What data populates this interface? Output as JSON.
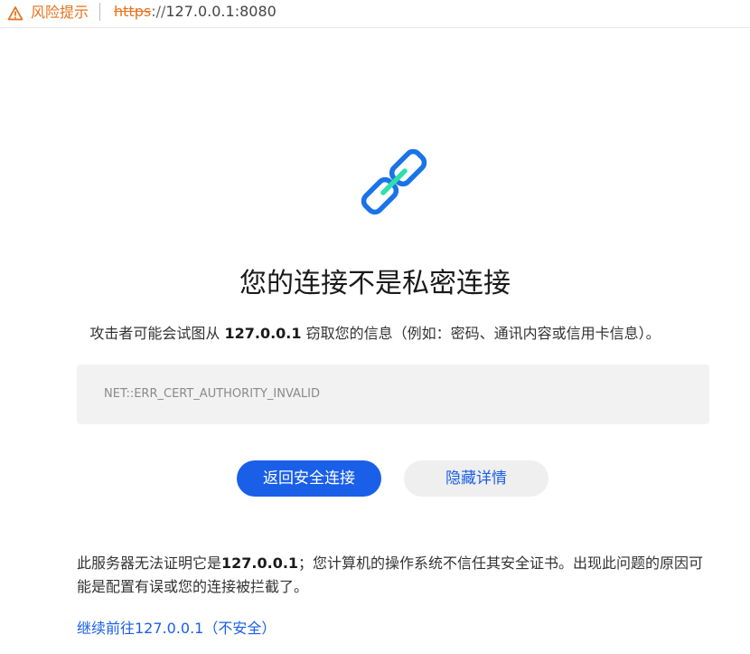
{
  "addressbar": {
    "warning_label": "风险提示",
    "url_scheme": "https",
    "url_separator": "://",
    "url_host": "127.0.0.1:8080"
  },
  "icons": {
    "warning": "warning-triangle-icon",
    "hero": "broken-link-icon"
  },
  "main": {
    "title": "您的连接不是私密连接",
    "desc_prefix": "攻击者可能会试图从 ",
    "desc_host": "127.0.0.1",
    "desc_suffix": " 窃取您的信息（例如：密码、通讯内容或信用卡信息）。",
    "error_code": "NET::ERR_CERT_AUTHORITY_INVALID",
    "back_button": "返回安全连接",
    "details_button": "隐藏详情",
    "detail_prefix": "此服务器无法证明它是",
    "detail_host": "127.0.0.1",
    "detail_suffix": "；您计算机的操作系统不信任其安全证书。出现此问题的原因可能是配置有误或您的连接被拦截了。",
    "proceed_link": "继续前往127.0.0.1（不安全）"
  },
  "colors": {
    "warning": "#e8721c",
    "accent": "#1a5fe8",
    "icon_blue": "#1a73e8",
    "icon_green": "#2fe0a8",
    "error_box_bg": "#f2f2f2"
  }
}
